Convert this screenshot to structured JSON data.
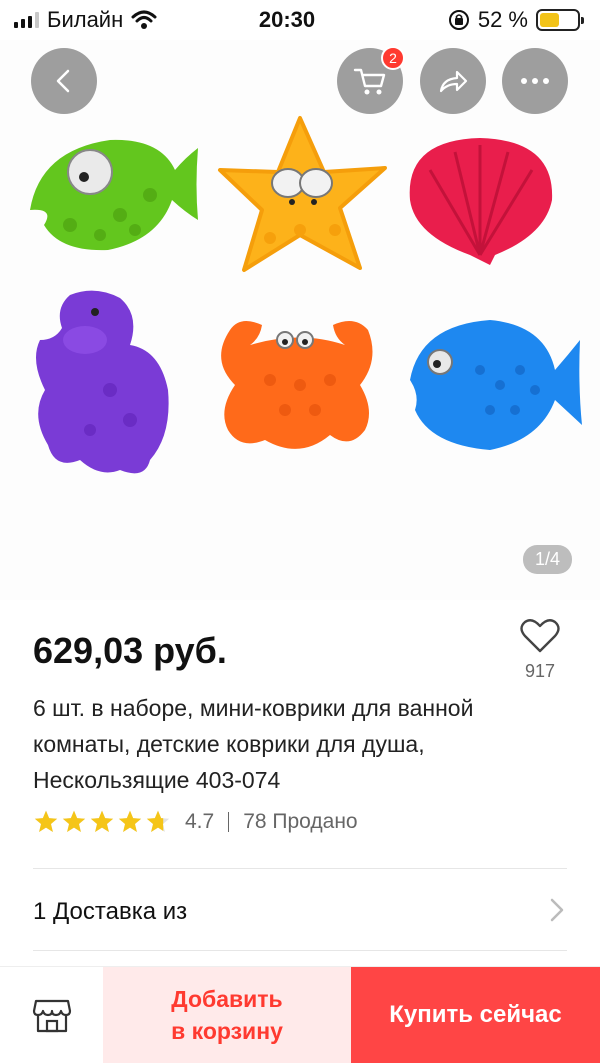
{
  "status_bar": {
    "carrier": "Билайн",
    "time": "20:30",
    "battery_percent": "52 %",
    "battery_level": 0.52
  },
  "top_actions": {
    "cart_badge": "2"
  },
  "gallery": {
    "page_indicator": "1/4",
    "items": [
      "green-fish",
      "yellow-starfish",
      "red-shell",
      "purple-hippo",
      "orange-crab",
      "blue-fish"
    ]
  },
  "product": {
    "price": "629,03 руб.",
    "wishlist_count": "917",
    "title": "6 шт. в наборе, мини-коврики для ванной комнаты, детские коврики для душа, Нескользящие 403-074",
    "rating": "4.7",
    "rating_stars": 4.7,
    "sold": "78 Продано",
    "delivery_label": "1 Доставка из"
  },
  "bottom_bar": {
    "add_to_cart_line1": "Добавить",
    "add_to_cart_line2": "в корзину",
    "buy_now": "Купить сейчас"
  },
  "colors": {
    "accent_red": "#ff4545",
    "add_cart_bg": "#ffeaea",
    "star": "#f5c518"
  }
}
